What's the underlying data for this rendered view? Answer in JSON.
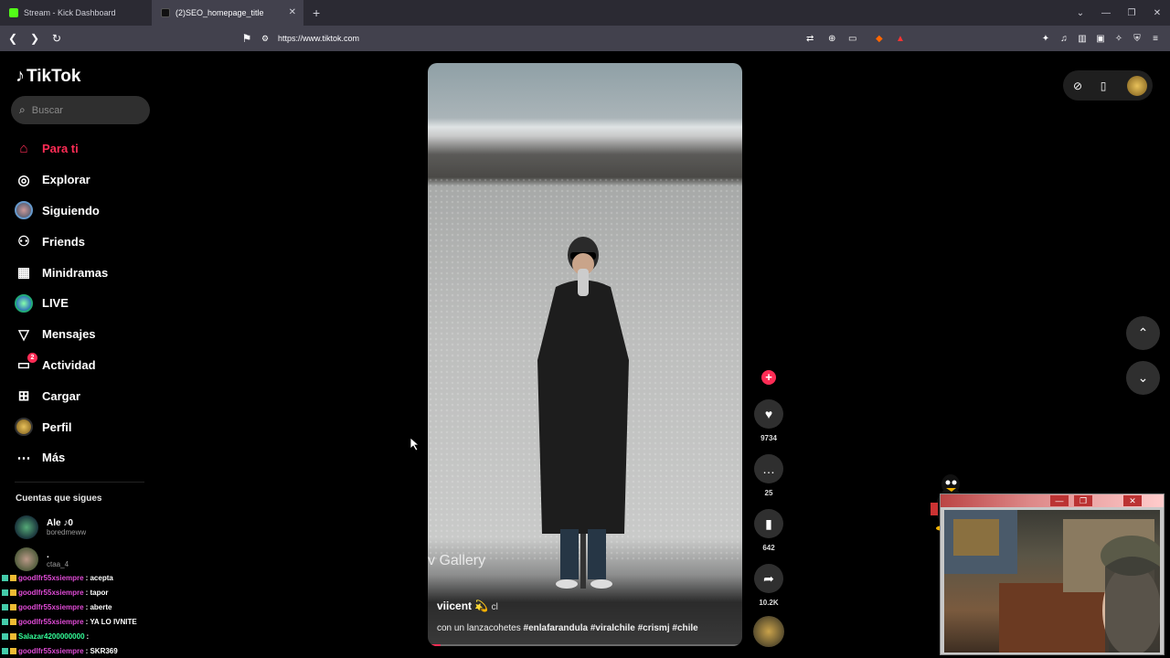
{
  "browser": {
    "tabs": [
      {
        "title": "Stream - Kick Dashboard",
        "color": "#53fc18",
        "active": false
      },
      {
        "title": "(2)SEO_homepage_title",
        "color": "#ffffff",
        "active": true
      }
    ],
    "url": "https://www.tiktok.com"
  },
  "tiktok": {
    "logo": "TikTok",
    "search_placeholder": "Buscar",
    "nav": [
      {
        "label": "Para ti",
        "icon": "home-icon",
        "active": true
      },
      {
        "label": "Explorar",
        "icon": "compass-icon"
      },
      {
        "label": "Siguiendo",
        "icon": "following-avatar-icon"
      },
      {
        "label": "Friends",
        "icon": "friends-icon"
      },
      {
        "label": "Minidramas",
        "icon": "film-icon"
      },
      {
        "label": "LIVE",
        "icon": "live-icon"
      },
      {
        "label": "Mensajes",
        "icon": "send-icon"
      },
      {
        "label": "Actividad",
        "icon": "activity-icon",
        "badge": "2"
      },
      {
        "label": "Cargar",
        "icon": "upload-icon"
      },
      {
        "label": "Perfil",
        "icon": "profile-icon"
      },
      {
        "label": "Más",
        "icon": "more-icon"
      }
    ],
    "following_title": "Cuentas que sigues",
    "following": [
      {
        "name": "Ale ♪0",
        "username": "boredmeww"
      },
      {
        "name": ".",
        "username": "ctaa_4"
      }
    ],
    "video": {
      "watermark": "v Gallery",
      "author": "viicent 💫",
      "author_suffix": "cl",
      "caption_prefix": "con un lanzacohetes",
      "hashtags": "#enlafarandula #viralchile #crismj #chile",
      "progress": 0.04
    },
    "actions": {
      "likes": "9734",
      "comments": "25",
      "saves": "642",
      "shares": "10.2K"
    }
  },
  "chat": [
    {
      "user": "goodlfr55xsiempre",
      "msg": ": acepta",
      "user_color": "#e04bd6"
    },
    {
      "user": "goodlfr55xsiempre",
      "msg": ": tapor",
      "user_color": "#e04bd6"
    },
    {
      "user": "goodlfr55xsiempre",
      "msg": ": aberte",
      "user_color": "#e04bd6"
    },
    {
      "user": "goodlfr55xsiempre",
      "msg": ": YA LO IVNITE",
      "user_color": "#e04bd6"
    },
    {
      "user": "Salazar4200000000",
      "msg": ":",
      "user_color": "#33ff99"
    },
    {
      "user": "goodlfr55xsiempre",
      "msg": ": SKR369",
      "user_color": "#e04bd6"
    }
  ]
}
